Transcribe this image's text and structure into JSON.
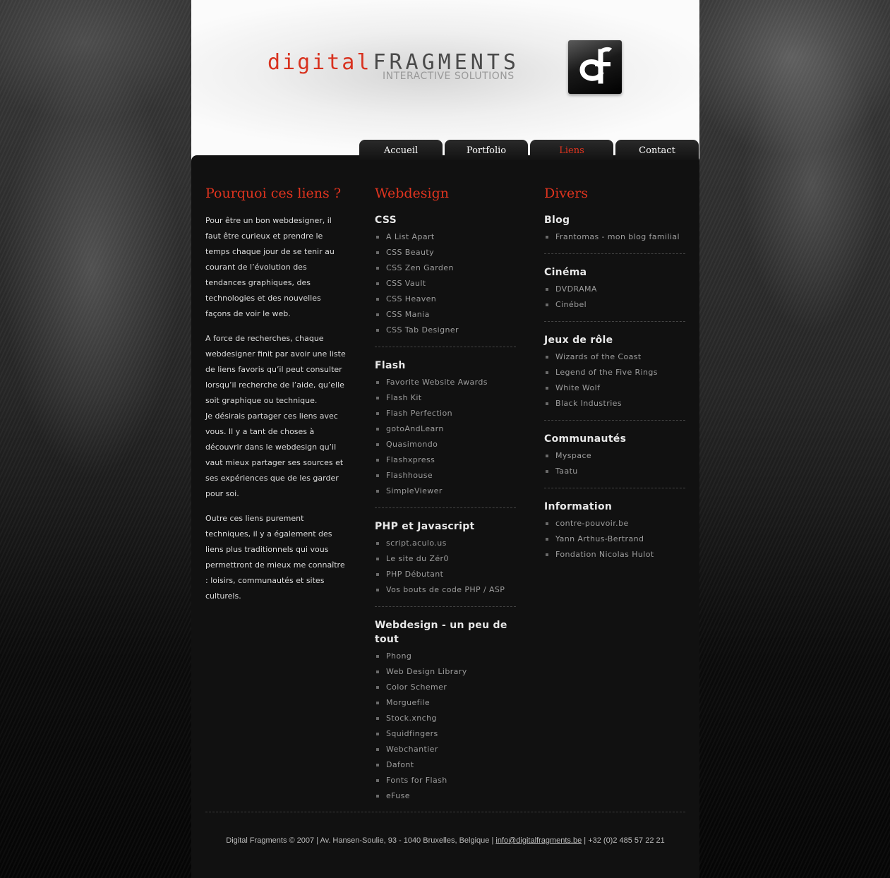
{
  "logo": {
    "word1": "digital",
    "word2": "FRAGMENTS",
    "tagline": "INTERACTIVE SOLUTIONS",
    "mark_letters": "df"
  },
  "colors": {
    "accent": "#e0341f",
    "panel": "#111111",
    "text": "#dcdcdc",
    "link": "#9d9d9d"
  },
  "nav": {
    "tabs": [
      {
        "label": "Accueil",
        "active": false
      },
      {
        "label": "Portfolio",
        "active": false
      },
      {
        "label": "Liens",
        "active": true
      },
      {
        "label": "Contact",
        "active": false
      }
    ]
  },
  "intro": {
    "title": "Pourquoi ces liens ?",
    "p1": "Pour être un bon webdesigner, il faut être curieux et prendre le temps chaque jour de se tenir au courant de l’évolution des tendances graphiques, des technologies et des nouvelles façons de voir le web.",
    "p2a": "A force de recherches, chaque webdesigner finit par avoir une liste de liens favoris qu’il peut consulter lorsqu’il recherche de l’aide, qu’elle soit graphique ou technique.",
    "p2b": "Je désirais partager ces liens avec vous. Il y a tant de choses à découvrir dans le webdesign qu’il vaut mieux partager ses sources et ses expériences que de les garder pour soi.",
    "p3": "Outre ces liens purement techniques, il y a également des liens plus traditionnels qui vous permettront de mieux me connaître : loisirs, communautés et sites culturels."
  },
  "webdesign": {
    "title": "Webdesign",
    "groups": [
      {
        "heading": "CSS",
        "links": [
          "A List Apart",
          "CSS Beauty",
          "CSS Zen Garden",
          "CSS Vault",
          "CSS Heaven",
          "CSS Mania",
          "CSS Tab Designer"
        ]
      },
      {
        "heading": "Flash",
        "links": [
          "Favorite Website Awards",
          "Flash Kit",
          "Flash Perfection",
          "gotoAndLearn",
          "Quasimondo",
          "Flashxpress",
          "Flashhouse",
          "SimpleViewer"
        ]
      },
      {
        "heading": "PHP et Javascript",
        "links": [
          "script.aculo.us",
          "Le site du Zér0",
          "PHP Débutant",
          "Vos bouts de code PHP / ASP"
        ]
      },
      {
        "heading": "Webdesign - un peu de tout",
        "links": [
          "Phong",
          "Web Design Library",
          "Color Schemer",
          "Morguefile",
          "Stock.xnchg",
          "Squidfingers",
          "Webchantier",
          "Dafont",
          "Fonts for Flash",
          "eFuse"
        ]
      }
    ]
  },
  "divers": {
    "title": "Divers",
    "groups": [
      {
        "heading": "Blog",
        "links": [
          "Frantomas - mon blog familial"
        ]
      },
      {
        "heading": "Cinéma",
        "links": [
          "DVDRAMA",
          "Cinébel"
        ]
      },
      {
        "heading": "Jeux de rôle",
        "links": [
          "Wizards of the Coast",
          "Legend of the Five Rings",
          "White Wolf",
          "Black Industries"
        ]
      },
      {
        "heading": "Communautés",
        "links": [
          "Myspace",
          "Taatu"
        ]
      },
      {
        "heading": "Information",
        "links": [
          "contre-pouvoir.be",
          "Yann Arthus-Bertrand",
          "Fondation Nicolas Hulot"
        ]
      }
    ]
  },
  "footer": {
    "before": "Digital Fragments © 2007 | Av. Hansen-Soulie, 93 - 1040 Bruxelles, Belgique | ",
    "email": "info@digitalfragments.be",
    "after": " | +32 (0)2 485 57 22 21"
  }
}
